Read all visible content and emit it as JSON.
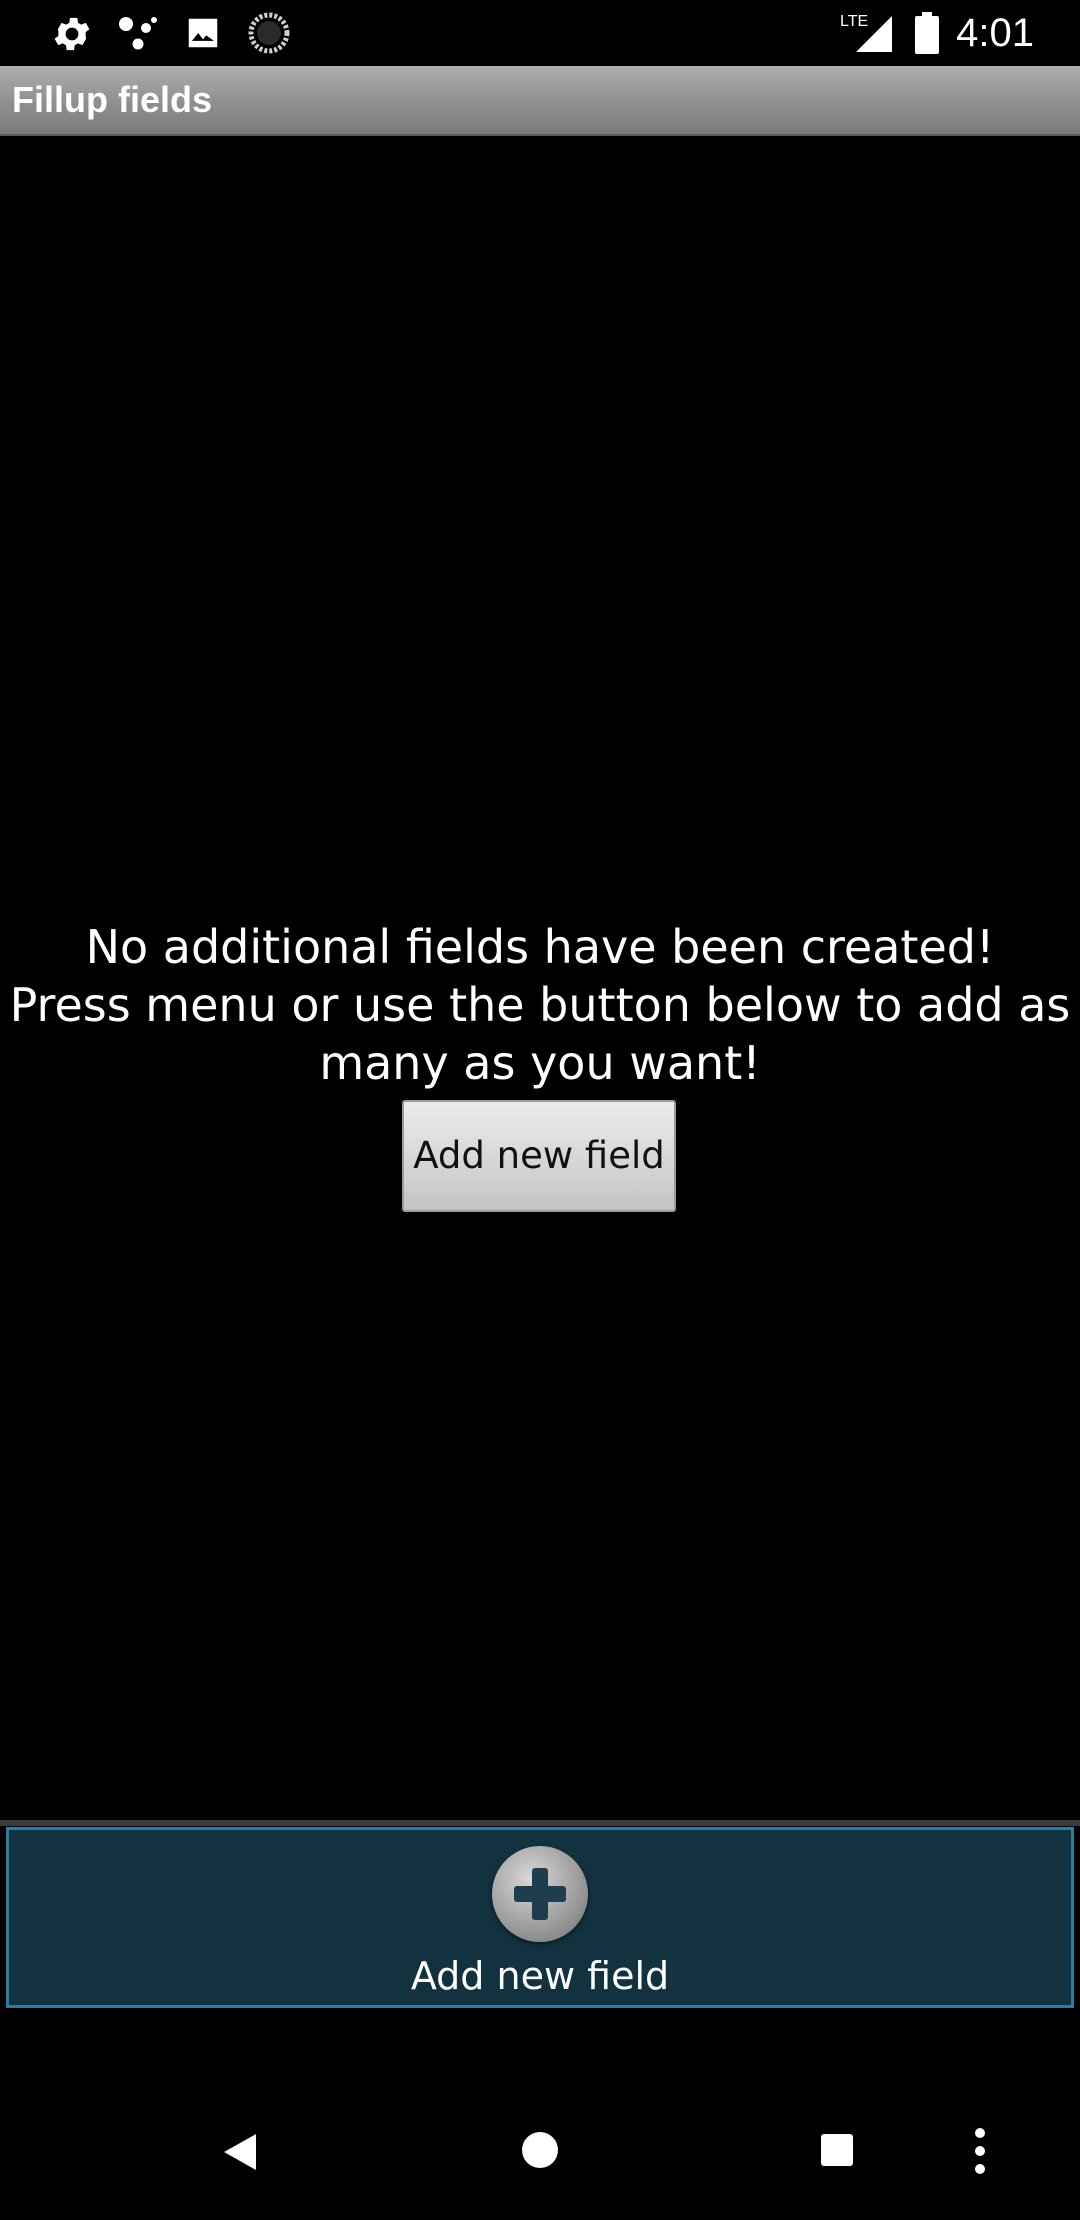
{
  "status_bar": {
    "time": "4:01",
    "network_label": "LTE",
    "icons": [
      "gear-icon",
      "assistant-dots-icon",
      "image-icon",
      "loading-circle-icon",
      "signal-icon",
      "battery-icon"
    ]
  },
  "title_bar": {
    "title": "Fillup fields"
  },
  "empty_state": {
    "line1": "No additional fields have been created!",
    "line2": "Press menu or use the button below to add as",
    "line3": "many as you want!",
    "button_label": "Add new field"
  },
  "bottom_panel": {
    "label": "Add new field",
    "icon": "plus-circle-icon",
    "accent_color": "#2e7c9e",
    "background_color": "#12323f"
  },
  "nav_bar": {
    "icons": [
      "back-icon",
      "home-icon",
      "recents-icon",
      "more-vert-icon"
    ]
  }
}
